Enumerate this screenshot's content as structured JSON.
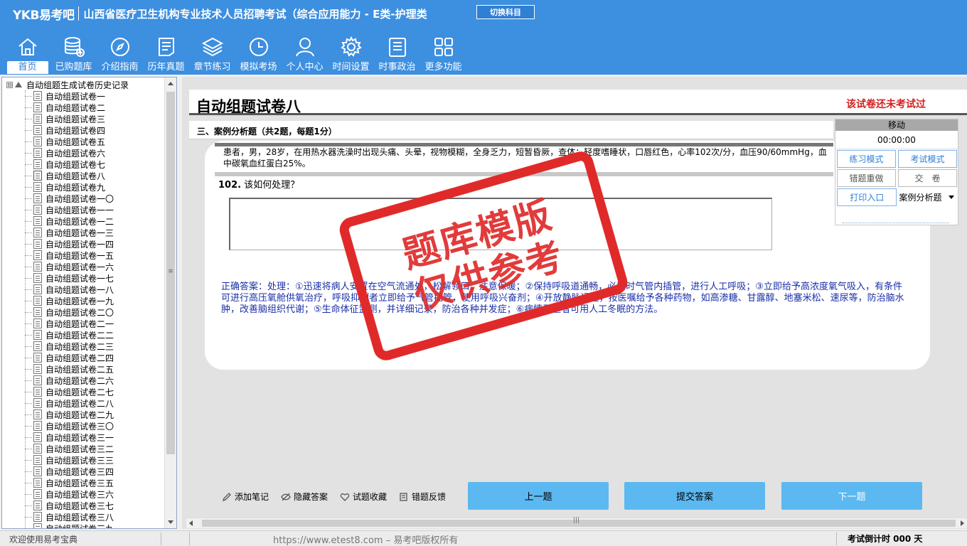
{
  "app": {
    "logo": "YKB易考吧",
    "title": "山西省医疗卫生机构专业技术人员招聘考试（综合应用能力 - E类-护理类",
    "switch_label": "切换科目"
  },
  "nav": {
    "items": [
      {
        "label": "首页",
        "icon": "home-icon"
      },
      {
        "label": "已购题库",
        "icon": "database-icon"
      },
      {
        "label": "介绍指南",
        "icon": "compass-icon"
      },
      {
        "label": "历年真题",
        "icon": "document-list-icon"
      },
      {
        "label": "章节练习",
        "icon": "layers-icon"
      },
      {
        "label": "模拟考场",
        "icon": "clock-icon"
      },
      {
        "label": "个人中心",
        "icon": "user-icon"
      },
      {
        "label": "时间设置",
        "icon": "gear-icon"
      },
      {
        "label": "时事政治",
        "icon": "news-icon"
      },
      {
        "label": "更多功能",
        "icon": "grid-icon"
      }
    ]
  },
  "sidebar": {
    "root_label": "自动组题生成试卷历史记录",
    "expander": "⊟",
    "items": [
      "自动组题试卷一",
      "自动组题试卷二",
      "自动组题试卷三",
      "自动组题试卷四",
      "自动组题试卷五",
      "自动组题试卷六",
      "自动组题试卷七",
      "自动组题试卷八",
      "自动组题试卷九",
      "自动组题试卷一〇",
      "自动组题试卷一一",
      "自动组题试卷一二",
      "自动组题试卷一三",
      "自动组题试卷一四",
      "自动组题试卷一五",
      "自动组题试卷一六",
      "自动组题试卷一七",
      "自动组题试卷一八",
      "自动组题试卷一九",
      "自动组题试卷二〇",
      "自动组题试卷二一",
      "自动组题试卷二二",
      "自动组题试卷二三",
      "自动组题试卷二四",
      "自动组题试卷二五",
      "自动组题试卷二六",
      "自动组题试卷二七",
      "自动组题试卷二八",
      "自动组题试卷二九",
      "自动组题试卷三〇",
      "自动组题试卷三一",
      "自动组题试卷三二",
      "自动组题试卷三三",
      "自动组题试卷三四",
      "自动组题试卷三五",
      "自动组题试卷三六",
      "自动组题试卷三七",
      "自动组题试卷三八",
      "自动组题试卷三九"
    ]
  },
  "paper": {
    "title": "自动组题试卷八",
    "status": "该试卷还未考试过",
    "section": "三、案例分析题（共2题，每题1分）",
    "case_text": "患者，男，28岁，在用热水器洗澡时出现头痛、头晕，视物模糊，全身乏力，短暂昏厥，查体：轻度嗜睡状，口唇红色，心率102次/分，血压90/60mmHg，血中碳氧血红蛋白25%。",
    "question_no": "102.",
    "question": "该如何处理？",
    "answer": "正确答案：处理：①迅速将病人安置在空气流通处，松解领口，注意保暖；②保持呼吸道通畅，必要时气管内插管，进行人工呼吸；③立即给予高浓度氧气吸入，有条件可进行高压氧舱供氧治疗，呼吸抑制者立即给予气管插管，使用呼吸兴奋剂；④开放静脉通道，按医嘱给予各种药物，如高渗糖、甘露醇、地塞米松、速尿等，防治脑水肿，改善脑组织代谢；⑤生命体征监测，并详细记录，防治各种并发症；⑥病情严重者可用人工冬眠的方法。"
  },
  "stamp": {
    "line1": "题库模版",
    "line2": "仅供参考",
    "color": "#e02a2a"
  },
  "right_panel": {
    "head": "移动",
    "timer": "00:00:00",
    "practice_mode": "练习模式",
    "exam_mode": "考试模式",
    "redo_wrong": "错题重做",
    "submit_paper": "交　卷",
    "print": "打印入口",
    "type_select": "案例分析题"
  },
  "tools": {
    "add_note": "添加笔记",
    "hide_answer": "隐藏答案",
    "favorite": "试题收藏",
    "feedback": "错题反馈"
  },
  "buttons": {
    "prev": "上一题",
    "submit": "提交答案",
    "next": "下一题",
    "color": "#5cb8f0"
  },
  "status": {
    "left": "欢迎使用易考宝典",
    "middle": "https://www.etest8.com – 易考吧版权所有",
    "right": "考试倒计时 000 天"
  },
  "colors": {
    "header": "#3d8fe0",
    "status_red": "#d42020",
    "answer_blue": "#1a2fa8"
  }
}
